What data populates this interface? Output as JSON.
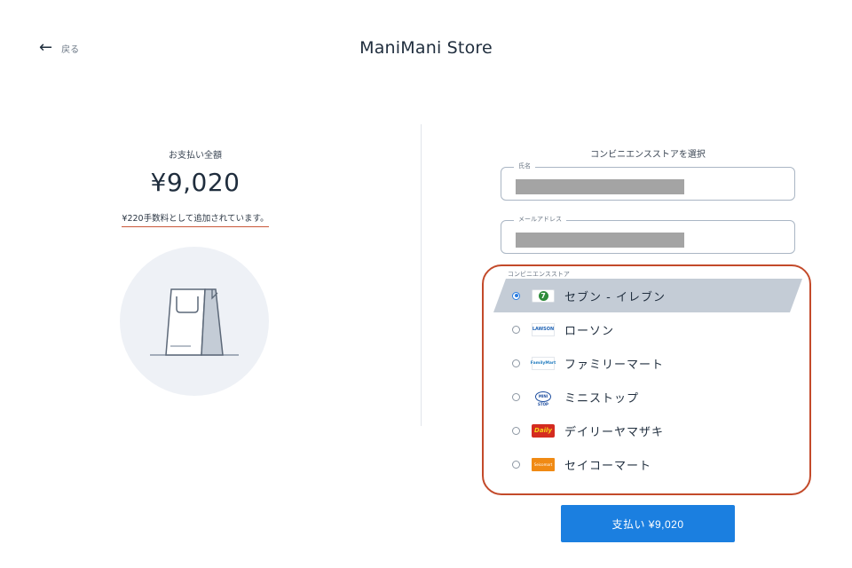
{
  "header": {
    "back_label": "戻る",
    "store_name": "ManiMani Store"
  },
  "summary": {
    "total_label": "お支払い全額",
    "total_amount": "¥9,020",
    "fee_note": "¥220手数料として追加されています。"
  },
  "form": {
    "title": "コンビニエンスストアを選択",
    "name_field": {
      "label": "氏名",
      "value_redacted": true
    },
    "email_field": {
      "label": "メールアドレス",
      "value_redacted": true
    },
    "store_group_label": "コンビニエンスストア",
    "stores": [
      {
        "label": "セブン - イレブン",
        "logo": "seven-eleven-logo",
        "logo_text": "7",
        "selected": true
      },
      {
        "label": "ローソン",
        "logo": "lawson-logo",
        "logo_text": "LAWSON",
        "selected": false
      },
      {
        "label": "ファミリーマート",
        "logo": "familymart-logo",
        "logo_text": "FamilyMart",
        "selected": false
      },
      {
        "label": "ミニストップ",
        "logo": "ministop-logo",
        "logo_text": "MINI STOP",
        "selected": false
      },
      {
        "label": "デイリーヤマザキ",
        "logo": "daily-yamazaki-logo",
        "logo_text": "Daily",
        "selected": false
      },
      {
        "label": "セイコーマート",
        "logo": "seicomart-logo",
        "logo_text": "Seicomart",
        "selected": false
      }
    ]
  },
  "pay_button": {
    "label": "支払い ¥9,020"
  },
  "colors": {
    "accent": "#1b7fe0",
    "highlight_border": "#c34a2a",
    "selected_row": "#c4ccd6",
    "fee_underline": "#c9583a"
  }
}
